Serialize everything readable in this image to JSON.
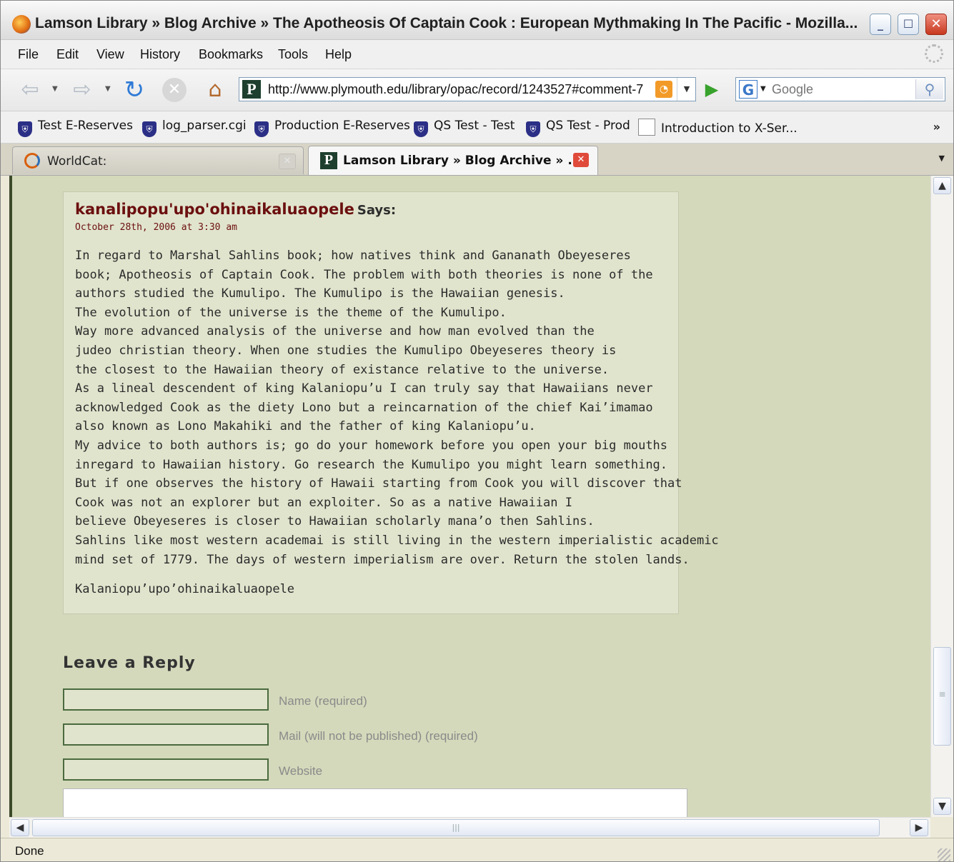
{
  "window": {
    "title": "Lamson Library » Blog Archive » The Apotheosis Of Captain Cook : European Mythmaking In The Pacific - Mozilla...",
    "minimize_glyph": "_",
    "maximize_glyph": "☐",
    "close_glyph": "✕"
  },
  "menu": {
    "items": [
      "File",
      "Edit",
      "View",
      "History",
      "Bookmarks",
      "Tools",
      "Help"
    ]
  },
  "nav": {
    "back_glyph": "⇦",
    "forward_glyph": "⇨",
    "dropdown_glyph": "▼",
    "reload_glyph": "↻",
    "stop_glyph": "✕",
    "home_glyph": "⌂",
    "site_icon_letter": "P",
    "url": "http://www.plymouth.edu/library/opac/record/1243527#comment-7",
    "rss_glyph": "◔",
    "go_glyph": "▶",
    "search_engine_letter": "G",
    "search_placeholder": "Google",
    "search_glyph": "⚲"
  },
  "bookmarks": {
    "items": [
      "Test E-Reserves",
      "log_parser.cgi",
      "Production E-Reserves",
      "QS Test - Test",
      "QS Test - Prod",
      "Introduction to X-Ser..."
    ],
    "shield_glyph": "⛨",
    "overflow_glyph": "»"
  },
  "tabs": {
    "items": [
      {
        "label": "WorldCat:",
        "active": false
      },
      {
        "label": "Lamson Library » Blog Archive » ...",
        "active": true
      }
    ],
    "close_glyph": "✕",
    "list_glyph": "▼"
  },
  "comment": {
    "author": "kanalipopu'upo'ohinaikaluaopele",
    "says": "Says:",
    "date": "October 28th, 2006 at 3:30 am",
    "lines": [
      "In regard to Marshal Sahlins book; how natives think and Gananath Obeyeseres",
      "book; Apotheosis of Captain Cook. The problem with both theories is none of the",
      "authors studied the Kumulipo. The Kumulipo is the Hawaiian genesis.",
      "The evolution of the universe is the theme of the Kumulipo.",
      "Way more advanced analysis of the universe and how man evolved than the",
      "judeo christian theory. When one studies the Kumulipo Obeyeseres theory is",
      "the closest to the Hawaiian theory of existance relative to the universe.",
      "As a lineal descendent of king Kalaniopu’u I can truly say that Hawaiians never",
      "acknowledged Cook as the diety Lono but a reincarnation of the chief Kai’imamao",
      "also known as Lono Makahiki and the father of king Kalaniopu’u.",
      "My advice to both authors is; go do your homework before you open your big mouths",
      "inregard to Hawaiian history. Go research the Kumulipo you might learn something.",
      "But if one observes the history of Hawaii starting from Cook you will discover that",
      "Cook was not an explorer but an exploiter. So as a native Hawaiian I",
      "believe Obeyeseres is closer to Hawaiian scholarly mana’o then Sahlins.",
      "Sahlins like most western academai is still living in the western imperialistic academic",
      "mind set of 1779. The days of western imperialism are over. Return the stolen lands."
    ],
    "signature": "Kalaniopu’upo’ohinaikaluaopele"
  },
  "reply": {
    "title": "Leave a Reply",
    "name_label": "Name (required)",
    "mail_label": "Mail (will not be published) (required)",
    "website_label": "Website"
  },
  "scrollbars": {
    "up_glyph": "▲",
    "down_glyph": "▼",
    "left_glyph": "◀",
    "right_glyph": "▶",
    "grip_glyph": "≡",
    "hgrip_glyph": "|||"
  },
  "status": {
    "text": "Done"
  }
}
